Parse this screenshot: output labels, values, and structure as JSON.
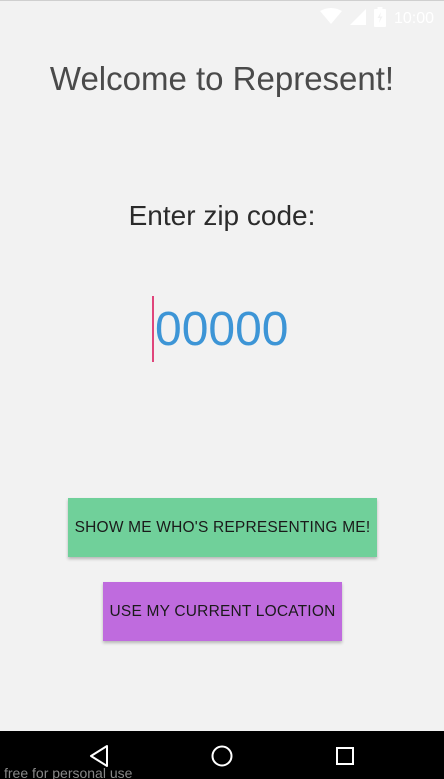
{
  "status_bar": {
    "time": "10:00",
    "icons": [
      "wifi-icon",
      "cell-signal-icon",
      "battery-icon"
    ]
  },
  "app": {
    "title": "Welcome to Represent!",
    "prompt": "Enter zip code:"
  },
  "zip_input": {
    "value": "",
    "placeholder": "00000"
  },
  "buttons": {
    "represent_label": "SHOW ME WHO'S REPRESENTING ME!",
    "location_label": "USE MY CURRENT LOCATION"
  },
  "nav_bar": {
    "icons": [
      "back-icon",
      "home-icon",
      "recents-icon"
    ]
  },
  "watermark": "free for personal use",
  "colors": {
    "background": "#f2f2f2",
    "zip_text": "#3d95d6",
    "caret": "#e0457b",
    "represent_button": "#70d09a",
    "location_button": "#bf6bde",
    "nav_bar": "#000000"
  }
}
